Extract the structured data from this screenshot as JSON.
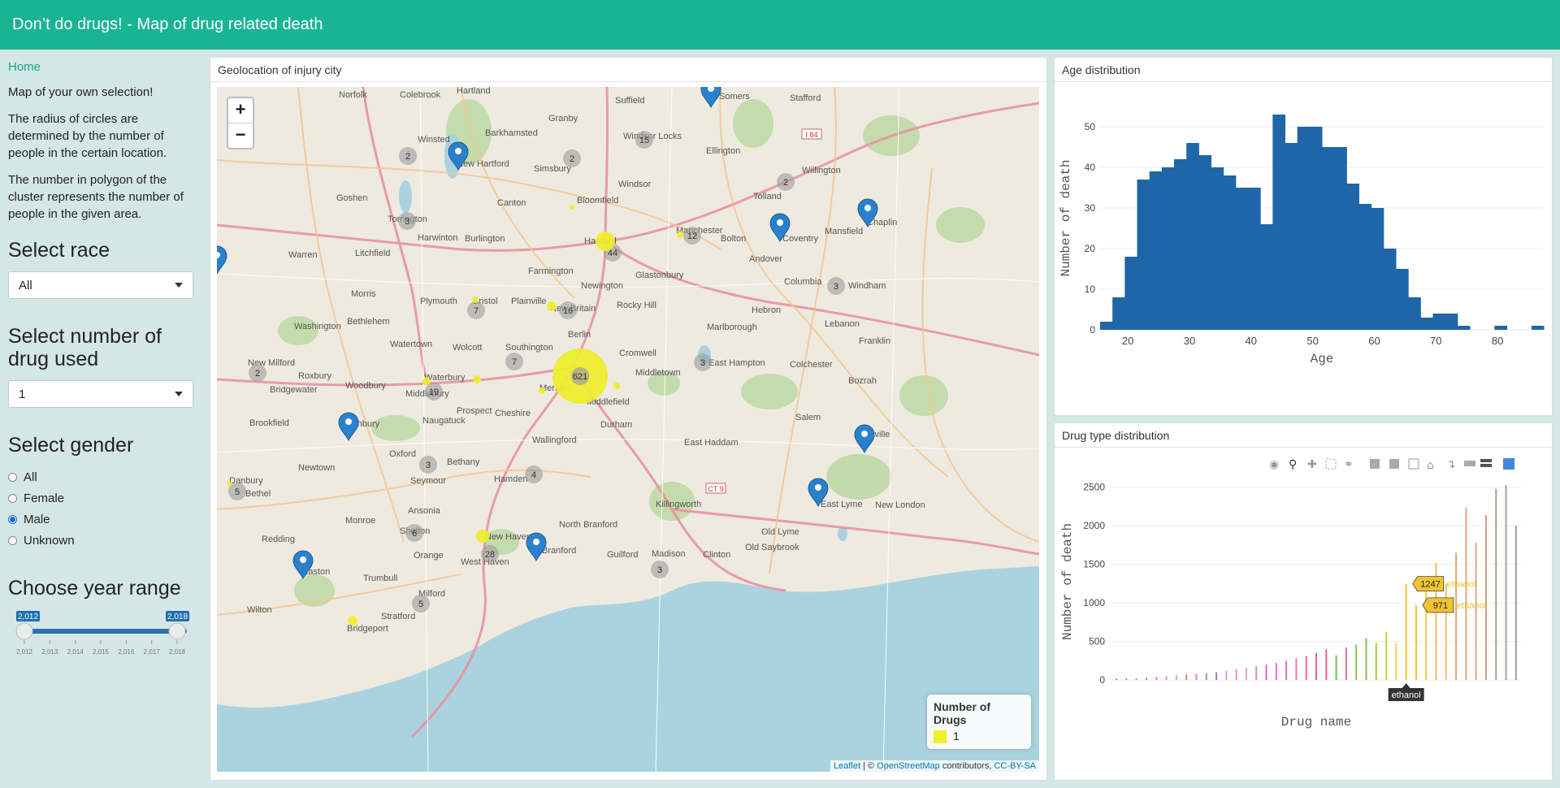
{
  "header": {
    "title": "Don’t do drugs! - Map of drug related death"
  },
  "sidebar": {
    "home_label": "Home",
    "intro": "Map of your own selection!",
    "radius_note": "The radius of circles are determined by the number of people in the certain location.",
    "cluster_note": "The number in polygon of the cluster represents the number of people in the given area.",
    "race": {
      "label": "Select race",
      "value": "All"
    },
    "drug_count": {
      "label": "Select number of drug used",
      "value": "1"
    },
    "gender": {
      "label": "Select gender",
      "options": [
        "All",
        "Female",
        "Male",
        "Unknown"
      ],
      "selected": "Male"
    },
    "year": {
      "label": "Choose year range",
      "min_label": "2,012",
      "max_label": "2,018",
      "ticks": [
        "2,012",
        "2,013",
        "2,014",
        "2,015",
        "2,016",
        "2,017",
        "2,018"
      ],
      "range": [
        2012,
        2018
      ]
    }
  },
  "map_panel": {
    "title": "Geolocation of injury city",
    "zoom_in": "+",
    "zoom_out": "−",
    "legend_title": "Number of Drugs",
    "legend_item": "1",
    "attribution": {
      "leaflet": "Leaflet",
      "sep": " | © ",
      "osm": "OpenStreetMap",
      "contrib": " contributors, ",
      "license": "CC-BY-SA"
    },
    "places": [
      "Norfolk",
      "Colebrook",
      "Hartland",
      "Suffield",
      "Somers",
      "Stafford",
      "Granby",
      "Barkhamsted",
      "Winsted",
      "New Hartford",
      "Windsor Locks",
      "Ellington",
      "Simsbury",
      "Willington",
      "Canton",
      "Windsor",
      "Tolland",
      "Goshen",
      "Torrington",
      "Harwinton",
      "Burlington",
      "Bloomfield",
      "Manchester",
      "Bolton",
      "Coventry",
      "Mansfield",
      "Chaplin",
      "Litchfield",
      "Warren",
      "Farmington",
      "Hartford",
      "Andover",
      "Glastonbury",
      "Newington",
      "Columbia",
      "Windham",
      "Morris",
      "Bristol",
      "Plainville",
      "New Britain",
      "Rocky Hill",
      "Hebron",
      "Plymouth",
      "Washington",
      "Bethlehem",
      "Berlin",
      "Marlborough",
      "Lebanon",
      "Watertown",
      "Wolcott",
      "Southington",
      "Cromwell",
      "Franklin",
      "New Milford",
      "Waterbury",
      "Middletown",
      "East Hampton",
      "Colchester",
      "Roxbury",
      "Woodbury",
      "Middlebury",
      "Meriden",
      "Middlefield",
      "Bozrah",
      "Bridgewater",
      "Prospect",
      "Cheshire",
      "Durham",
      "Southbury",
      "Naugatuck",
      "Brookfield",
      "Wallingford",
      "Salem",
      "Montville",
      "Oxford",
      "Bethany",
      "East Haddam",
      "Newtown",
      "Seymour",
      "Hamden",
      "Killingworth",
      "East Lyme",
      "New London",
      "Danbury",
      "Bethel",
      "Ansonia",
      "Monroe",
      "North Branford",
      "Redding",
      "Shelton",
      "New Haven",
      "Branford",
      "Old Lyme",
      "Orange",
      "West Haven",
      "Guilford",
      "Madison",
      "Clinton",
      "Old Saybrook",
      "Easton",
      "Trumbull",
      "Milford",
      "Wilton",
      "Stratford",
      "Bridgeport"
    ],
    "clusters": [
      "2",
      "2",
      "15",
      "2",
      "12",
      "44",
      "3",
      "7",
      "16",
      "7",
      "621",
      "3",
      "2",
      "19",
      "3",
      "4",
      "5",
      "6",
      "28",
      "3",
      "5",
      "3"
    ],
    "road_labels": [
      "I 84",
      "CT 9"
    ]
  },
  "age_chart": {
    "title": "Age distribution",
    "chart_data": {
      "type": "bar",
      "xlabel": "Age",
      "ylabel": "Number of death",
      "xlim": [
        15.5,
        87.5
      ],
      "ylim": [
        0,
        55
      ],
      "xticks": [
        20,
        30,
        40,
        50,
        60,
        70,
        80
      ],
      "yticks": [
        0,
        10,
        20,
        30,
        40,
        50
      ],
      "bin_width": 2,
      "bin_starts": [
        15.5,
        17.5,
        19.5,
        21.5,
        23.5,
        25.5,
        27.5,
        29.5,
        31.5,
        33.5,
        35.5,
        37.5,
        39.5,
        41.5,
        43.5,
        45.5,
        47.5,
        49.5,
        51.5,
        53.5,
        55.5,
        57.5,
        59.5,
        61.5,
        63.5,
        65.5,
        67.5,
        69.5,
        71.5,
        73.5,
        75.5,
        77.5,
        79.5,
        81.5,
        83.5,
        85.5
      ],
      "values": [
        2,
        8,
        18,
        37,
        39,
        40,
        42,
        46,
        43,
        40,
        38,
        35,
        35,
        26,
        53,
        46,
        50,
        50,
        45,
        45,
        36,
        31,
        30,
        20,
        15,
        8,
        3,
        4,
        4,
        1,
        0,
        0,
        1,
        0,
        0,
        1
      ],
      "color": "#1f66a9"
    }
  },
  "drug_chart": {
    "title": "Drug type distribution",
    "tooltip_values": [
      "1247",
      "971"
    ],
    "tooltip_name": "ethanol",
    "axis_hover_label": "ethanol",
    "chart_data": {
      "type": "bar",
      "xlabel": "Drug name",
      "ylabel": "Number of death",
      "ylim": [
        0,
        2550
      ],
      "yticks": [
        0,
        500,
        1000,
        1500,
        2000,
        2500
      ],
      "values": [
        15,
        20,
        25,
        30,
        40,
        50,
        60,
        70,
        80,
        90,
        100,
        120,
        140,
        160,
        180,
        200,
        220,
        250,
        280,
        310,
        350,
        400,
        320,
        420,
        460,
        540,
        480,
        620,
        480,
        1247,
        971,
        1320,
        1520,
        1250,
        1650,
        2240,
        1780,
        2140,
        2480,
        2530,
        2000
      ],
      "colors": [
        "#6a7fb0",
        "#8fa0c4",
        "#c7a3c7",
        "#9b88c2",
        "#e57ca4",
        "#d99a9a",
        "#f19da0",
        "#e07a7a",
        "#c98bd8",
        "#b28ad6",
        "#8e7dd6",
        "#e3a0d0",
        "#ef8fb7",
        "#e9a6bf",
        "#d48dd1",
        "#e06c9f",
        "#cf78c9",
        "#d874b4",
        "#ef7aa0",
        "#e86f8a",
        "#e65fa1",
        "#f06292",
        "#6fbf5a",
        "#d96ea0",
        "#8dc44f",
        "#7ec25e",
        "#a4cc3c",
        "#c8d848",
        "#f2d24a",
        "#f1c232",
        "#f2c032",
        "#f5c542",
        "#efb964",
        "#ecc070",
        "#e8a772",
        "#e6a77f",
        "#d8a88a",
        "#c9a08e",
        "#b39d94",
        "#a4a09c",
        "#9e9e9e"
      ],
      "hover_category": "ethanol"
    }
  }
}
